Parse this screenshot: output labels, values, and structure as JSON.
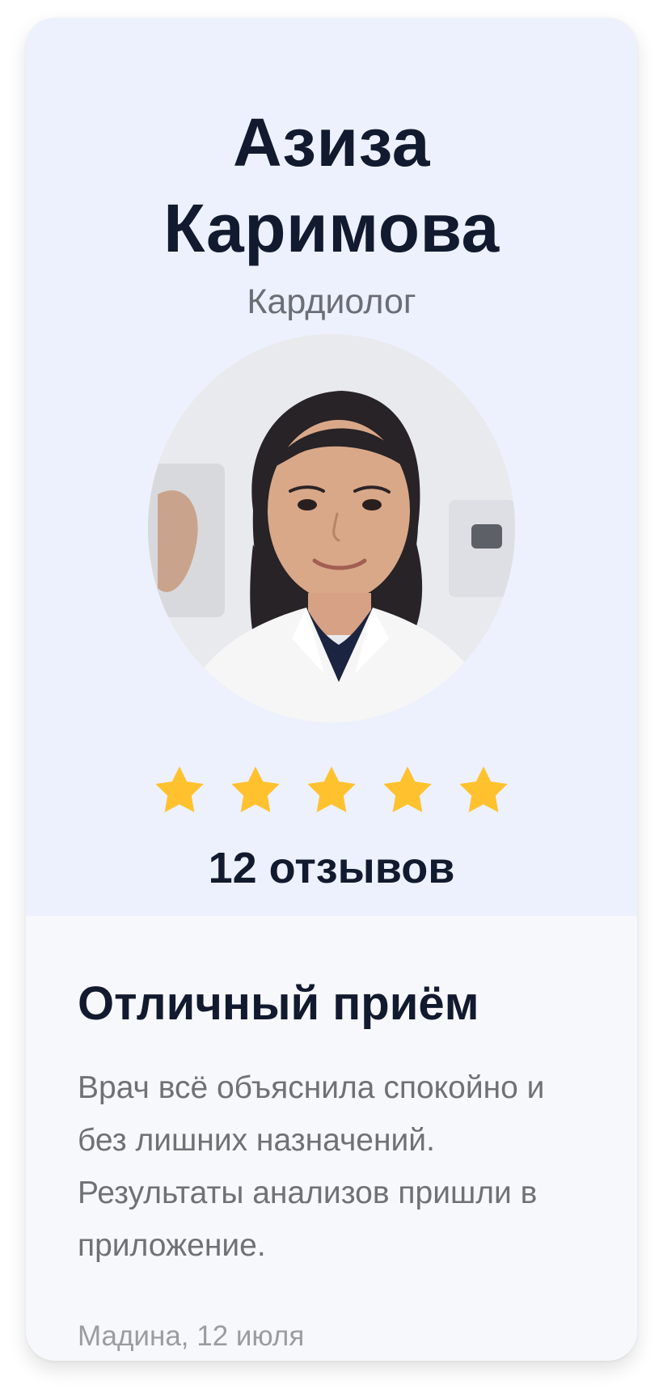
{
  "doctor": {
    "name_line1": "Азиза",
    "name_line2": "Каримова",
    "specialty": "Кардиолог"
  },
  "rating": {
    "stars": 5,
    "max_stars": 5,
    "reviews_count": "12 отзывов"
  },
  "review": {
    "title": "Отличный приём",
    "text": "Врач всё объяснила спокойно и без лишних назначений. Результаты анализов пришли в приложение.",
    "author_date": "Мадина, 12 июля"
  },
  "colors": {
    "card_top_background": "#edf1fd",
    "text_primary": "#111a2e",
    "star": "#ffc22e"
  },
  "icons": {
    "rating_star": "star-icon"
  }
}
